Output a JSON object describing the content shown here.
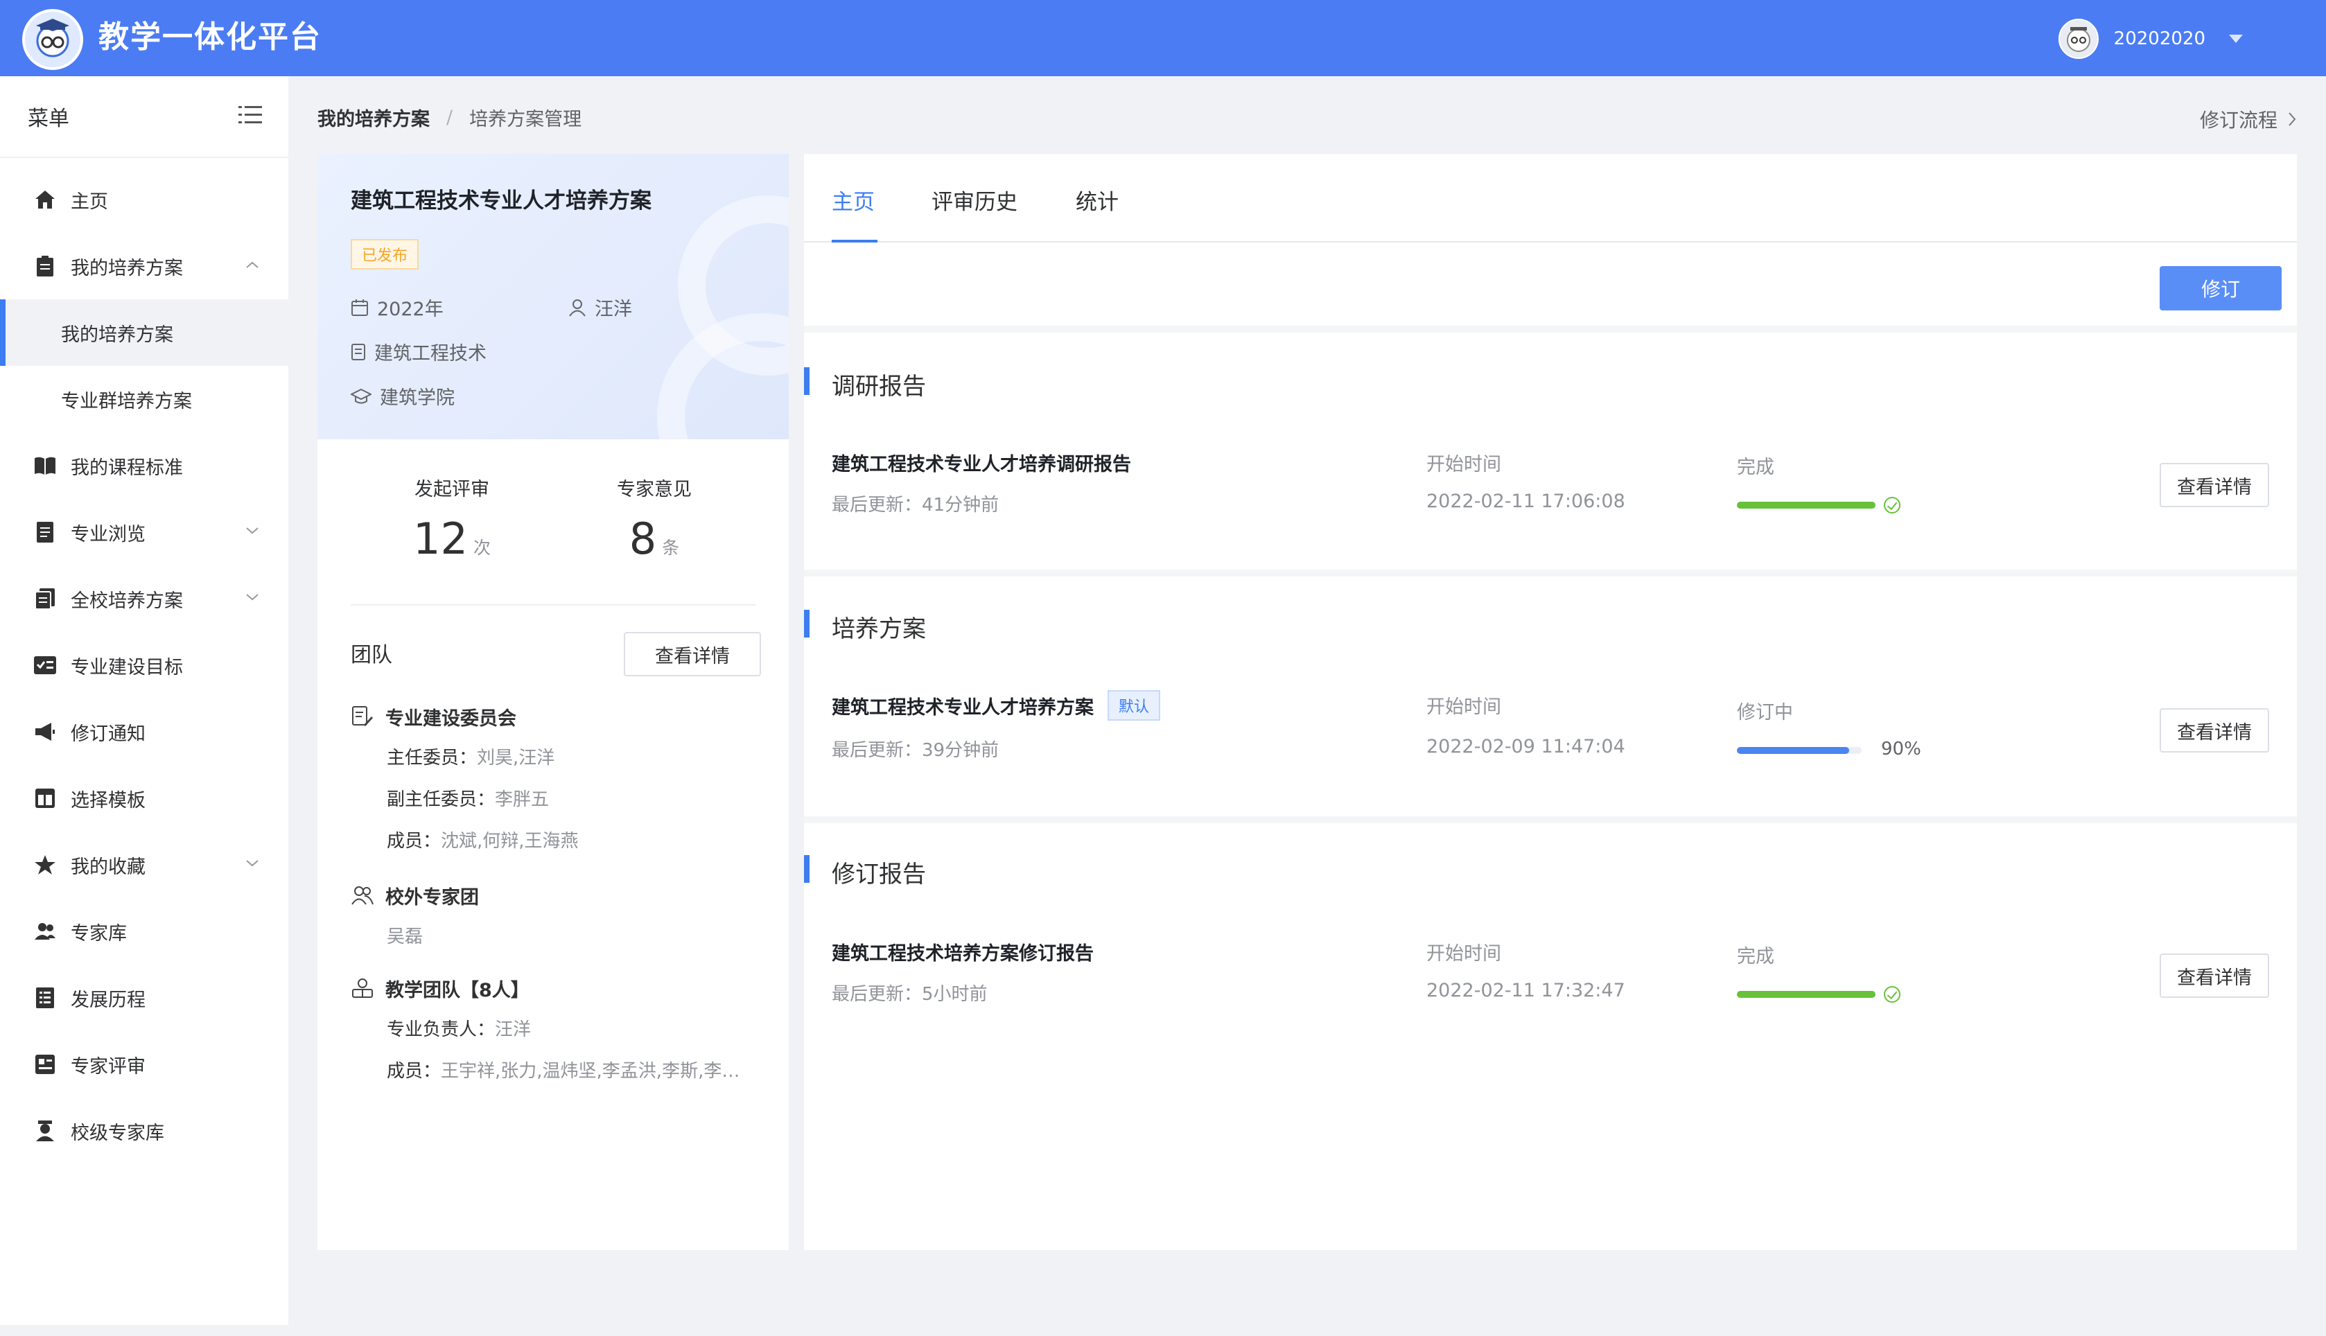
{
  "header": {
    "app_title": "教学一体化平台",
    "user_name": "20202020",
    "brand_color": "#4b7cf3"
  },
  "sidebar": {
    "title": "菜单",
    "items": [
      {
        "label": "主页",
        "icon": "home-icon"
      },
      {
        "label": "我的培养方案",
        "icon": "clipboard-icon",
        "expanded": true
      },
      {
        "label": "我的培养方案",
        "sub": true,
        "active": true
      },
      {
        "label": "专业群培养方案",
        "sub": true
      },
      {
        "label": "我的课程标准",
        "icon": "book-icon"
      },
      {
        "label": "专业浏览",
        "icon": "document-icon",
        "expandable": true
      },
      {
        "label": "全校培养方案",
        "icon": "documents-icon",
        "expandable": true
      },
      {
        "label": "专业建设目标",
        "icon": "checklist-icon"
      },
      {
        "label": "修订通知",
        "icon": "megaphone-icon"
      },
      {
        "label": "选择模板",
        "icon": "template-icon"
      },
      {
        "label": "我的收藏",
        "icon": "star-icon",
        "expandable": true
      },
      {
        "label": "专家库",
        "icon": "people-icon"
      },
      {
        "label": "发展历程",
        "icon": "history-icon"
      },
      {
        "label": "专家评审",
        "icon": "review-icon"
      },
      {
        "label": "校级专家库",
        "icon": "expert-icon"
      }
    ]
  },
  "breadcrumb": {
    "level1": "我的培养方案",
    "level2": "培养方案管理",
    "flow_link": "修订流程"
  },
  "plan": {
    "title": "建筑工程技术专业人才培养方案",
    "status": "已发布",
    "year": "2022年",
    "owner": "汪洋",
    "major": "建筑工程技术",
    "college": "建筑学院",
    "stats": {
      "reviews_label": "发起评审",
      "reviews_value": "12",
      "reviews_unit": "次",
      "opinions_label": "专家意见",
      "opinions_value": "8",
      "opinions_unit": "条"
    },
    "team": {
      "title": "团队",
      "detail_button": "查看详情",
      "committee": {
        "title": "专业建设委员会",
        "director_key": "主任委员：",
        "director_val": "刘昊,汪洋",
        "vice_key": "副主任委员：",
        "vice_val": "李胖五",
        "members_key": "成员：",
        "members_val": "沈斌,何辩,王海燕"
      },
      "external": {
        "title": "校外专家团",
        "members_val": "吴磊"
      },
      "teaching": {
        "title": "教学团队【8人】",
        "lead_key": "专业负责人：",
        "lead_val": "汪洋",
        "members_key": "成员：",
        "members_val": "王宇祥,张力,温炜坚,李孟洪,李斯,李时..."
      }
    }
  },
  "main": {
    "tabs": [
      "主页",
      "评审历史",
      "统计"
    ],
    "active_tab": 0,
    "revise_button": "修订",
    "sections": [
      {
        "title": "调研报告",
        "name": "建筑工程技术专业人才培养调研报告",
        "updated": "最后更新：41分钟前",
        "start_label": "开始时间",
        "start_time": "2022-02-11 17:06:08",
        "status": "完成",
        "progress": 1.0,
        "detail_button": "查看详情"
      },
      {
        "title": "培养方案",
        "name": "建筑工程技术专业人才培养方案",
        "tag": "默认",
        "updated": "最后更新：39分钟前",
        "start_label": "开始时间",
        "start_time": "2022-02-09 11:47:04",
        "status": "修订中",
        "progress": 0.9,
        "progress_text": "90%",
        "detail_button": "查看详情"
      },
      {
        "title": "修订报告",
        "name": "建筑工程技术培养方案修订报告",
        "updated": "最后更新：5小时前",
        "start_label": "开始时间",
        "start_time": "2022-02-11 17:32:47",
        "status": "完成",
        "progress": 1.0,
        "detail_button": "查看详情"
      }
    ],
    "colors": {
      "accent": "#3d7df1",
      "success": "#67c23a",
      "in_progress": "#4a86f0"
    }
  }
}
